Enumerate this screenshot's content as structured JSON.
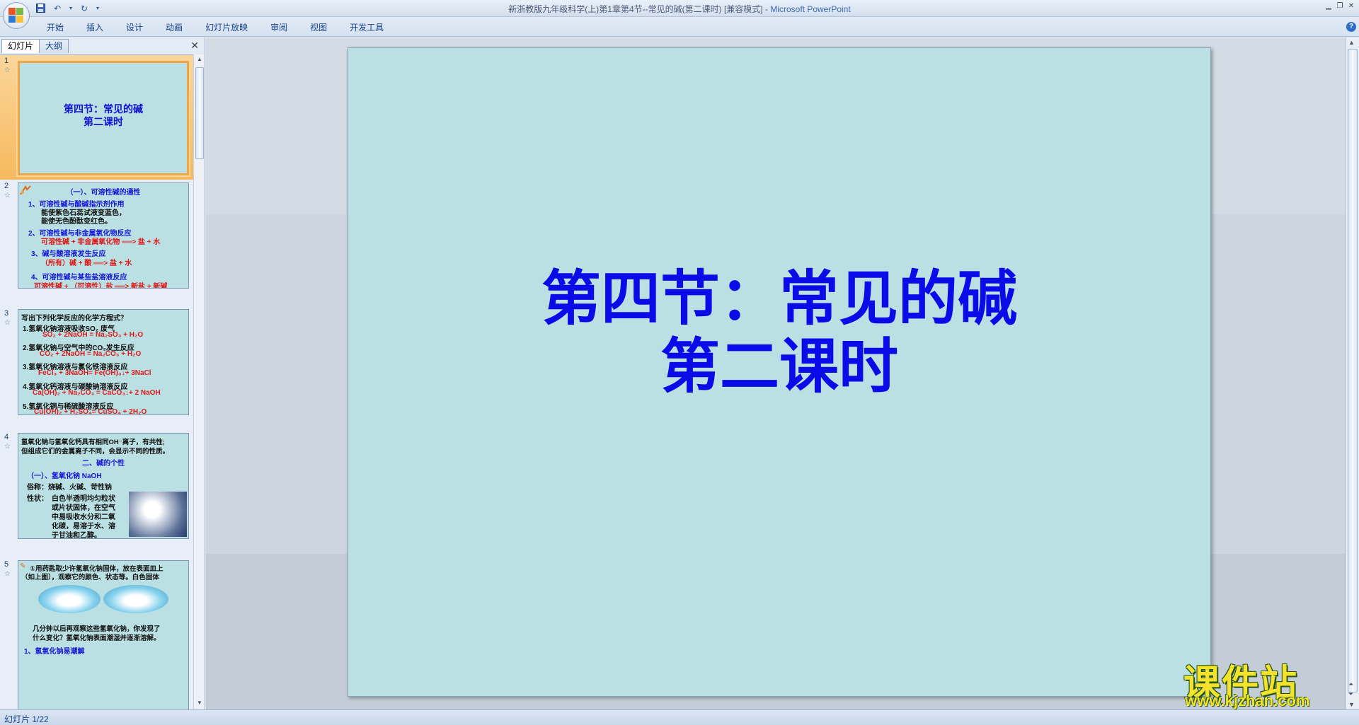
{
  "window": {
    "title": "新浙教版九年级科学(上)第1章第4节--常见的碱(第二课时) [兼容模式]",
    "separator": " - ",
    "app_name": "Microsoft PowerPoint"
  },
  "quick_access": {
    "save_icon": "save-icon",
    "undo_icon": "undo-icon",
    "redo_icon": "redo-icon",
    "customize_icon": "chevron-down-icon"
  },
  "ribbon": {
    "tabs": [
      "开始",
      "插入",
      "设计",
      "动画",
      "幻灯片放映",
      "审阅",
      "视图",
      "开发工具"
    ],
    "help_label": "?"
  },
  "left_pane": {
    "tabs": {
      "slides": "幻灯片",
      "outline": "大纲"
    },
    "close_label": "✕",
    "slides": [
      {
        "number": "1",
        "title_lines": [
          "第四节：常见的碱",
          "第二课时"
        ]
      },
      {
        "number": "2",
        "heading": "（一）、可溶性碱的通性",
        "l1": "1、可溶性碱与酸碱指示剂作用",
        "l1a": "能使紫色石蕊试液变蓝色，",
        "l1b": "能使无色酚酞变红色。",
        "l2": "2、可溶性碱与非金属氧化物反应",
        "l2a": "可溶性碱 + 非金属氧化物 ══> 盐 + 水",
        "l3": "3、碱与酸溶液发生反应",
        "l3a": "（所有）碱 + 酸 ══> 盐 + 水",
        "l4": "4、可溶性碱与某些盐溶液反应",
        "l4a": "可溶性碱 + （可溶性）盐 ══> 新盐 + 新碱"
      },
      {
        "number": "3",
        "q": "写出下列化学反应的化学方程式？",
        "q1": "1.氢氧化钠溶液吸收SO₂ 废气",
        "a1": "SO₂ + 2NaOH = Na₂SO₃ + H₂O",
        "q2": "2.氢氧化钠与空气中的CO₂发生反应",
        "a2": "CO₂ + 2NaOH = Na₂CO₃ + H₂O",
        "q3": "3.氢氧化钠溶液与氯化铁溶液反应",
        "a3": "FeCl₃ + 3NaOH= Fe(OH)₃↓+ 3NaCl",
        "q4": "4.氢氧化钙溶液与碳酸钠溶液反应",
        "a4": "Ca(OH)₂ + Na₂CO₃ = CaCO₃↓+ 2 NaOH",
        "q5": "5.氢氧化铜与稀硫酸溶液反应",
        "a5": "Cu(OH)₂ + H₂SO₄= CuSO₄ + 2H₂O"
      },
      {
        "number": "4",
        "p1": "氢氧化钠与氢氧化钙具有相同OH⁻离子，有共性;",
        "p2": "但组成它们的金属离子不同，会显示不同的性质。",
        "heading": "二、碱的个性",
        "sub": "（一）、氢氧化钠   NaOH",
        "alias": "俗称：烧碱、火碱、苛性钠",
        "prop_label": "性状：",
        "prop_lines": [
          "白色半透明均匀粒状",
          "或片状固体，在空气",
          "中易吸收水分和二氧",
          "化碳，易溶于水、溶",
          "于甘油和乙醇。"
        ]
      },
      {
        "number": "5",
        "l1": "①用药匙取少许氢氧化钠固体，放在表面皿上",
        "l2": "（如上图），观察它的颜色、状态等。白色固体",
        "l3": "几分钟以后再观察这些氢氧化钠，你发现了",
        "l4": "什么变化？氢氧化钠表面潮湿并逐渐溶解。",
        "l5": "1、氢氧化钠易潮解"
      }
    ]
  },
  "main_slide": {
    "title_lines": [
      "第四节：常见的碱",
      "第二课时"
    ]
  },
  "watermark": {
    "text": "课件站",
    "url": "www.kjzhan.com"
  },
  "status": {
    "slide_indicator": "幻灯片 1/22"
  },
  "colors": {
    "slide_bg": "#bbe0e3",
    "title_blue": "#0b0be8",
    "accent_red": "#e01818",
    "selected_orange": "#f3a546"
  }
}
